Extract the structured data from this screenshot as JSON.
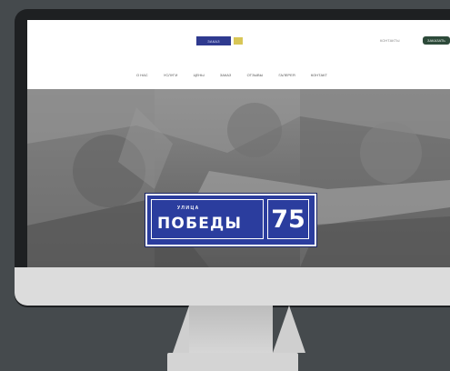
{
  "header": {
    "logo_text": "ЗАКАЗ",
    "header_link": "КОНТАКТЫ",
    "cta_label": "ЗАКАЗАТЬ"
  },
  "nav": {
    "items": [
      "О НАС",
      "УСЛУГИ",
      "ЦЕНЫ",
      "ЗАКАЗ",
      "ОТЗЫВЫ",
      "ГАЛЕРЕЯ",
      "КОНТАКТ"
    ]
  },
  "hero": {
    "sign_small_text": "УЛИЦА",
    "sign_street": "ПОБЕДЫ",
    "sign_number": "75",
    "sign_color": "#2b3d9e"
  }
}
